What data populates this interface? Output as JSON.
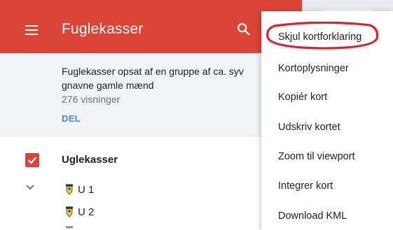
{
  "app": {
    "title": "Fuglekasser"
  },
  "map_info": {
    "description": "Fuglekasser opsat af en gruppe af ca. syv gnavne gamle mænd",
    "views": "276 visninger",
    "share_label": "DEL"
  },
  "layer": {
    "name": "Uglekasser",
    "checked": true,
    "items": [
      {
        "label": "U 1"
      },
      {
        "label": "U 2"
      },
      {
        "label": ""
      }
    ]
  },
  "menu": {
    "items": [
      {
        "label": "Skjul kortforklaring",
        "highlighted": true
      },
      {
        "label": "Kortoplysninger"
      },
      {
        "label": "Kopiér kort"
      },
      {
        "label": "Udskriv kortet"
      },
      {
        "label": "Zoom til viewport"
      },
      {
        "label": "Integrer kort"
      },
      {
        "label": "Download KML"
      }
    ]
  },
  "colors": {
    "appbar": "#db4437",
    "share_link": "#4285f4",
    "checkbox": "#db4437",
    "annotation_circle": "#e0202a",
    "pin_fill": "#f4d03f"
  },
  "icons": [
    "menu-icon",
    "search-icon",
    "checkbox-checked-icon",
    "chevron-down-icon",
    "owl-box-pin-icon"
  ]
}
